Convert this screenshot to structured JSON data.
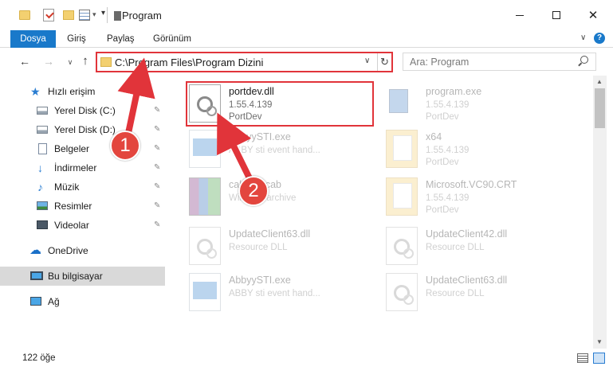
{
  "window": {
    "title": "Program",
    "minimize_icon": "minimize-icon",
    "maximize_icon": "maximize-icon",
    "close_label": "✕"
  },
  "ribbon": {
    "tabs": [
      "Dosya",
      "Giriş",
      "Paylaş",
      "Görünüm"
    ],
    "help_label": "?"
  },
  "nav": {
    "back": "←",
    "forward": "→",
    "recent": "∨",
    "up": "↑",
    "address": "C:\\Program Files\\Program Dizini",
    "refresh": "↻",
    "search_placeholder": "Ara: Program"
  },
  "sidebar": {
    "items": [
      {
        "label": "Hızlı erişim",
        "icon": "star-icon",
        "pinned": false
      },
      {
        "label": "Yerel Disk (C:)",
        "icon": "disk-icon",
        "pinned": true
      },
      {
        "label": "Yerel Disk (D:)",
        "icon": "disk-icon",
        "pinned": true
      },
      {
        "label": "Belgeler",
        "icon": "document-icon",
        "pinned": true
      },
      {
        "label": "İndirmeler",
        "icon": "download-icon",
        "pinned": true
      },
      {
        "label": "Müzik",
        "icon": "music-icon",
        "pinned": true
      },
      {
        "label": "Resimler",
        "icon": "pictures-icon",
        "pinned": true
      },
      {
        "label": "Videolar",
        "icon": "video-icon",
        "pinned": true
      },
      {
        "label": "OneDrive",
        "icon": "cloud-icon",
        "pinned": false
      },
      {
        "label": "Bu bilgisayar",
        "icon": "computer-icon",
        "pinned": false,
        "selected": true
      },
      {
        "label": "Ağ",
        "icon": "network-icon",
        "pinned": false
      }
    ],
    "pin_glyph": "📌"
  },
  "files": [
    {
      "name": "portdev.dll",
      "line1": "1.55.4.139",
      "line2": "PortDev",
      "icon": "dll-icon",
      "highlighted": true
    },
    {
      "name": "program.exe",
      "line1": "1.55.4.139",
      "line2": "PortDev",
      "icon": "exe-icon"
    },
    {
      "name": "AbbyySTI.exe",
      "line1": "ABBY sti event hand...",
      "line2": "",
      "icon": "exe-icon"
    },
    {
      "name": "x64",
      "line1": "1.55.4.139",
      "line2": "PortDev",
      "icon": "folder-icon"
    },
    {
      "name": "cabfiles.cab",
      "line1": "WinRAR archive",
      "line2": "",
      "icon": "archive-icon"
    },
    {
      "name": "Microsoft.VC90.CRT",
      "line1": "1.55.4.139",
      "line2": "PortDev",
      "icon": "folder-icon"
    },
    {
      "name": "UpdateClient63.dll",
      "line1": "Resource DLL",
      "line2": "",
      "icon": "dll-icon"
    },
    {
      "name": "UpdateClient42.dll",
      "line1": "Resource DLL",
      "line2": "",
      "icon": "dll-icon"
    },
    {
      "name": "AbbyySTI.exe",
      "line1": "ABBY sti event hand...",
      "line2": "",
      "icon": "exe-icon"
    },
    {
      "name": "UpdateClient63.dll",
      "line1": "Resource DLL",
      "line2": "",
      "icon": "dll-icon"
    }
  ],
  "annotations": {
    "step1": "1",
    "step2": "2",
    "color": "#e1343a"
  },
  "status": {
    "count": "122 öğe"
  },
  "scrollbar": {
    "up": "▲",
    "down": "▼"
  }
}
